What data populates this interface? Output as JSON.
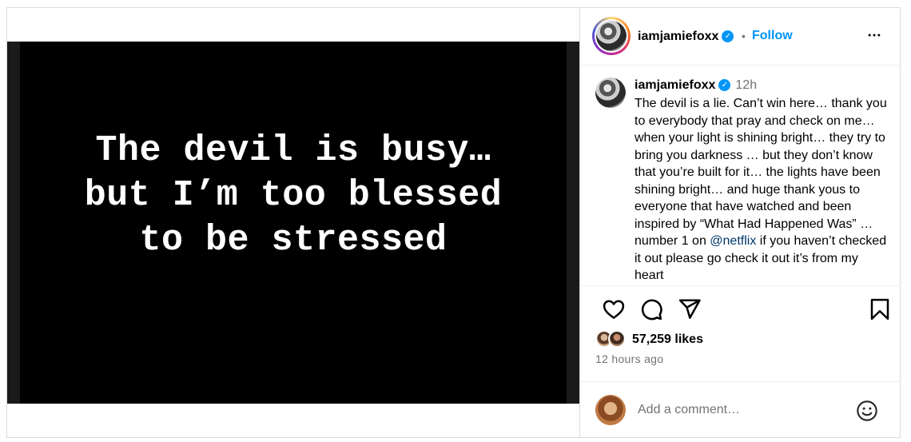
{
  "media": {
    "lines": [
      "The devil is busy…",
      "but I’m too blessed",
      "to be stressed"
    ]
  },
  "header": {
    "username": "iamjamiefoxx",
    "verified_glyph": "✓",
    "dot": "•",
    "follow_label": "Follow",
    "more_icon": "more-horizontal-icon"
  },
  "caption": {
    "username": "iamjamiefoxx",
    "verified_glyph": "✓",
    "time": "12h",
    "text_before": "The devil is a lie. Can’t win here… thank you to everybody that pray and check on me… when your light is shining bright… they try to bring you darkness … but they don’t know that you’re built for it… the lights have been shining bright… and huge thank yous to everyone that have watched and been inspired by “What Had Happened Was” … number 1 on ",
    "mention": "@netflix",
    "text_after": " if you haven’t checked it out please go check it out it’s from my heart"
  },
  "actions": {
    "icons": [
      "heart-icon",
      "comment-icon",
      "share-icon",
      "bookmark-icon"
    ]
  },
  "likes": {
    "count_text": "57,259 likes"
  },
  "posted": "12 hours ago",
  "comment": {
    "placeholder": "Add a comment…",
    "emoji_icon": "smiley-icon"
  },
  "colors": {
    "accent": "#0095f6",
    "muted": "#737373",
    "mention": "#00376b",
    "border": "#dbdbdb"
  }
}
